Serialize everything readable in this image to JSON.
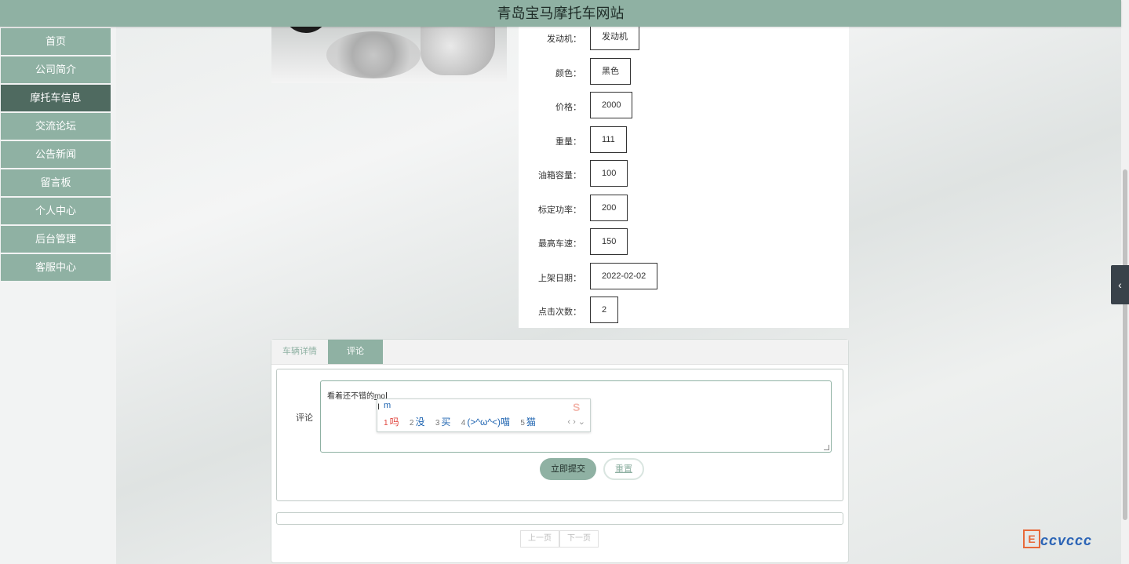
{
  "site_title": "青岛宝马摩托车网站",
  "nav": [
    {
      "label": "首页"
    },
    {
      "label": "公司简介"
    },
    {
      "label": "摩托车信息"
    },
    {
      "label": "交流论坛"
    },
    {
      "label": "公告新闻"
    },
    {
      "label": "留言板"
    },
    {
      "label": "个人中心"
    },
    {
      "label": "后台管理"
    },
    {
      "label": "客服中心"
    }
  ],
  "nav_active_index": 2,
  "specs": [
    {
      "label": "发动机：",
      "value": "发动机"
    },
    {
      "label": "颜色：",
      "value": "黑色"
    },
    {
      "label": "价格：",
      "value": "2000"
    },
    {
      "label": "重量：",
      "value": "111"
    },
    {
      "label": "油箱容量：",
      "value": "100"
    },
    {
      "label": "标定功率：",
      "value": "200"
    },
    {
      "label": "最高车速：",
      "value": "150"
    },
    {
      "label": "上架日期：",
      "value": "2022-02-02"
    },
    {
      "label": "点击次数：",
      "value": "2"
    }
  ],
  "tabs": [
    {
      "label": "车辆详情"
    },
    {
      "label": "评论"
    }
  ],
  "active_tab_index": 1,
  "comment": {
    "label": "评论",
    "text": "看着还不错的",
    "composing": "mo"
  },
  "ime": {
    "pinyin": "m",
    "candidates": [
      {
        "n": "1",
        "text": "吗"
      },
      {
        "n": "2",
        "text": "没"
      },
      {
        "n": "3",
        "text": "买"
      },
      {
        "n": "4",
        "text": "(>^ω^<)喵"
      },
      {
        "n": "5",
        "text": "猫"
      }
    ],
    "arrows": "‹ › ⌄"
  },
  "buttons": {
    "submit": "立即提交",
    "reset": "重置"
  },
  "pager": {
    "prev": "上一页",
    "next": "下一页"
  },
  "colors": {
    "primary": "#8fb1a3",
    "nav_active": "#4f6a60",
    "topbar_text": "#1f2d28"
  }
}
